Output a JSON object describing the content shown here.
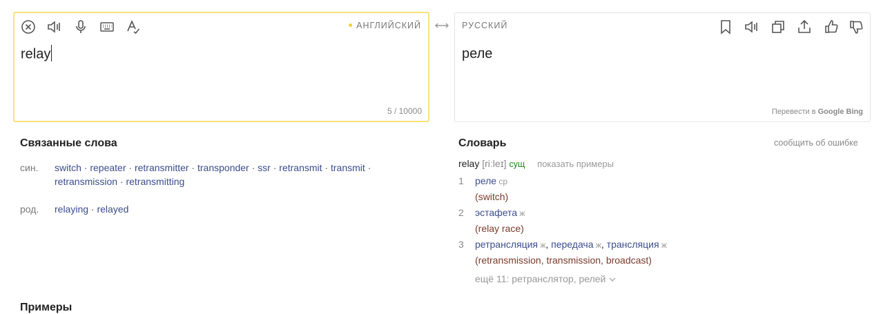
{
  "source": {
    "language": "АНГЛИЙСКИЙ",
    "text": "relay",
    "counter": "5 / 10000",
    "toolbar_icons": [
      "clear-icon",
      "speaker-icon",
      "microphone-icon",
      "keyboard-icon",
      "spellcheck-icon"
    ]
  },
  "target": {
    "language": "РУССКИЙ",
    "text": "реле",
    "powered_prefix": "Перевести в",
    "engine_google": "Google",
    "engine_bing": "Bing",
    "toolbar_icons": [
      "bookmark-icon",
      "speaker-icon",
      "copy-icon",
      "share-icon",
      "thumbs-up-icon",
      "thumbs-down-icon"
    ]
  },
  "related": {
    "title": "Связанные слова",
    "syn_label": "син.",
    "synonyms": [
      "switch",
      "repeater",
      "retransmitter",
      "transponder",
      "ssr",
      "retransmit",
      "transmit",
      "retransmission",
      "retransmitting"
    ],
    "rod_label": "род.",
    "forms": [
      "relaying",
      "relayed"
    ]
  },
  "dictionary": {
    "title": "Словарь",
    "report": "сообщить об ошибке",
    "headword": "relay",
    "transcription": "[riːleɪ]",
    "pos": "сущ",
    "show_examples": "показать примеры",
    "senses": [
      {
        "num": "1",
        "words": [
          {
            "w": "реле",
            "g": "ср"
          }
        ],
        "gloss": "(switch)"
      },
      {
        "num": "2",
        "words": [
          {
            "w": "эстафета",
            "g": "ж"
          }
        ],
        "gloss": "(relay race)"
      },
      {
        "num": "3",
        "words": [
          {
            "w": "ретрансляция",
            "g": "ж"
          },
          {
            "w": "передача",
            "g": "ж"
          },
          {
            "w": "трансляция",
            "g": "ж"
          }
        ],
        "gloss": "(retransmission, transmission, broadcast)"
      }
    ],
    "more": "ещё 11: ретранслятор, релей"
  },
  "examples": {
    "title": "Примеры"
  },
  "colors": {
    "accent": "#f6e27a",
    "link": "#3b4c8c",
    "gloss": "#7a3a2a",
    "pos": "#1a8a1a"
  }
}
